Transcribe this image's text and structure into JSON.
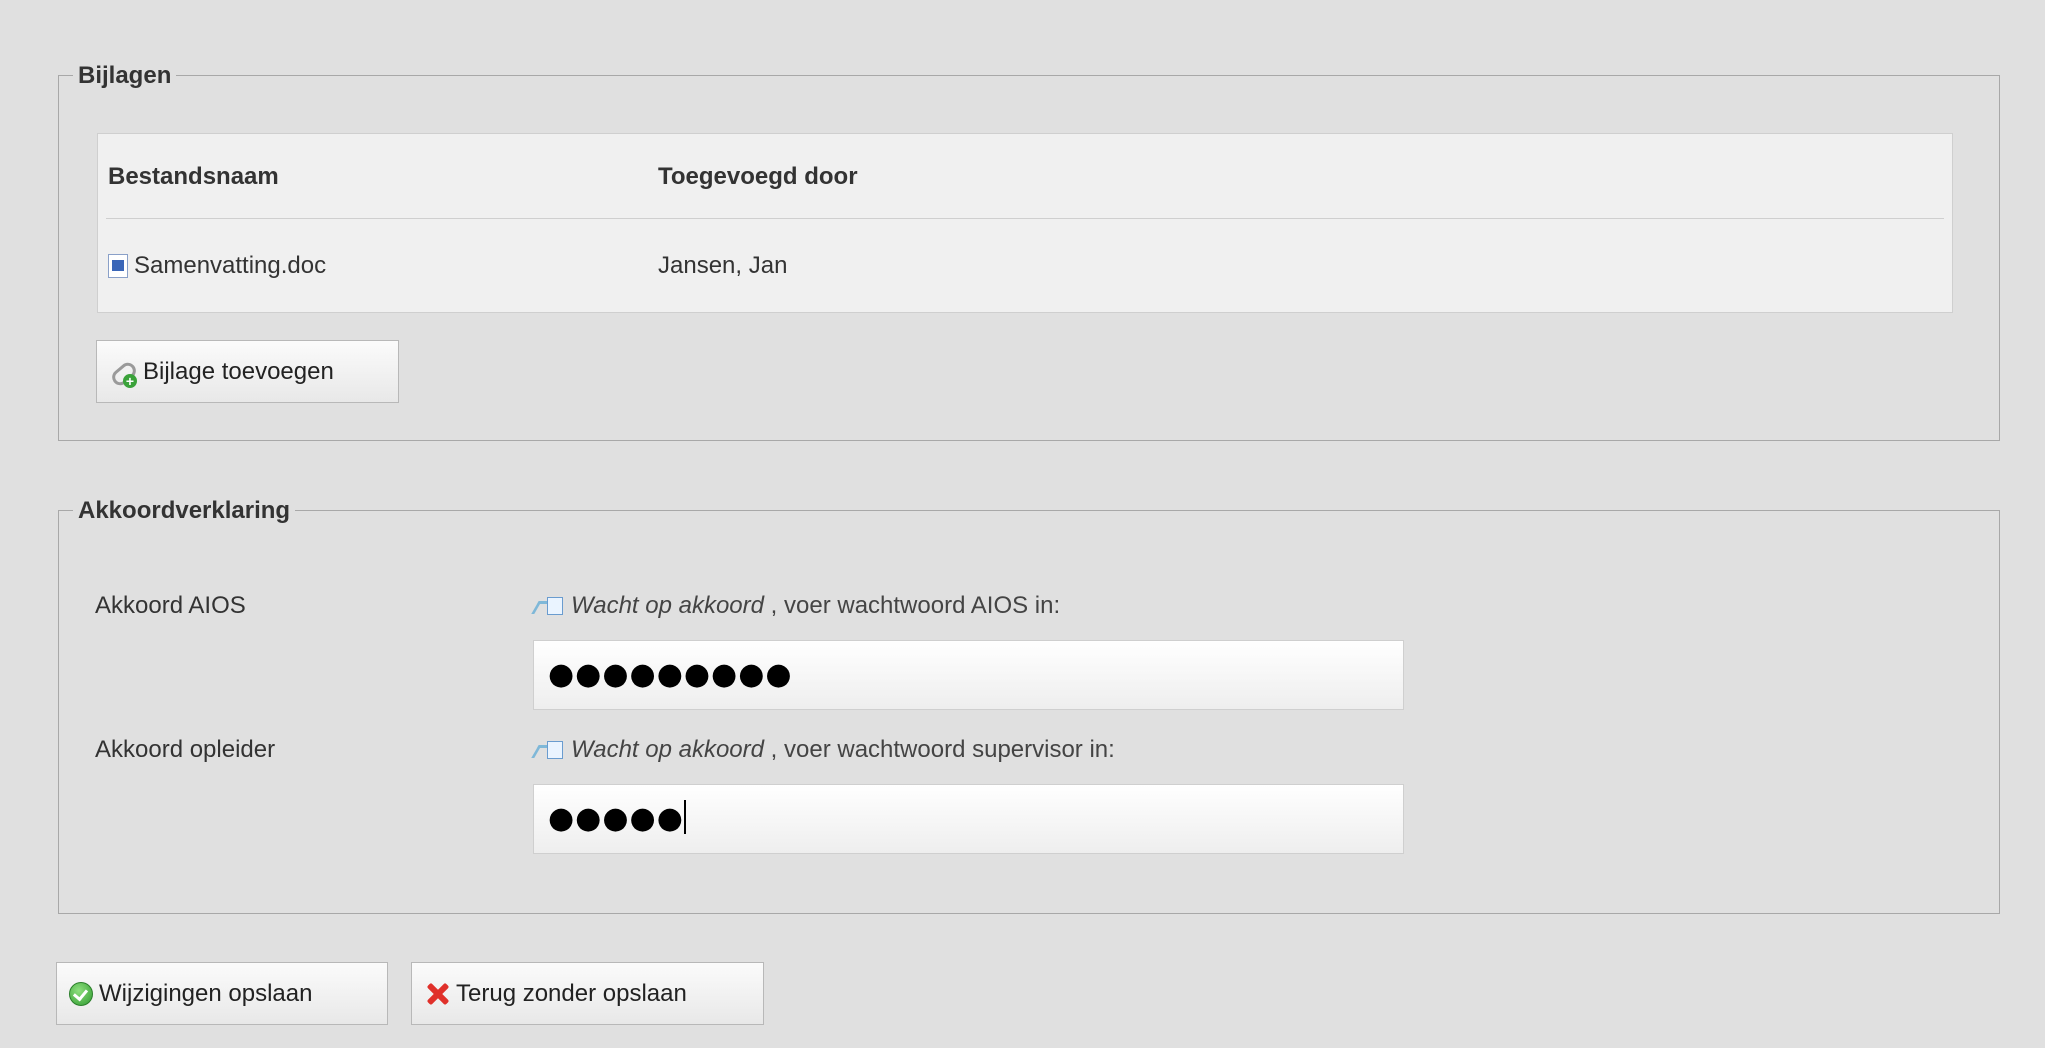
{
  "bijlagen": {
    "legend": "Bijlagen",
    "columns": [
      "Bestandsnaam",
      "Toegevoegd door"
    ],
    "rows": [
      {
        "filename": "Samenvatting.doc",
        "added_by": "Jansen, Jan",
        "icon": "word-document-icon"
      }
    ],
    "add_button_label": "Bijlage toevoegen"
  },
  "akkoord": {
    "legend": "Akkoordverklaring",
    "aios": {
      "label": "Akkoord AIOS",
      "status_italic": "Wacht op akkoord",
      "status_rest": " , voer wachtwoord AIOS in:",
      "password_mask": "●●●●●●●●●"
    },
    "opleider": {
      "label": "Akkoord opleider",
      "status_italic": "Wacht op akkoord",
      "status_rest": " , voer wachtwoord supervisor in:",
      "password_mask": "●●●●●"
    }
  },
  "actions": {
    "save_label": "Wijzigingen opslaan",
    "cancel_label": "Terug zonder opslaan"
  },
  "colors": {
    "background": "#e0e0e0",
    "border": "#a8a8a8",
    "ok_green": "#2f9a2f",
    "cancel_red": "#e0302a"
  }
}
